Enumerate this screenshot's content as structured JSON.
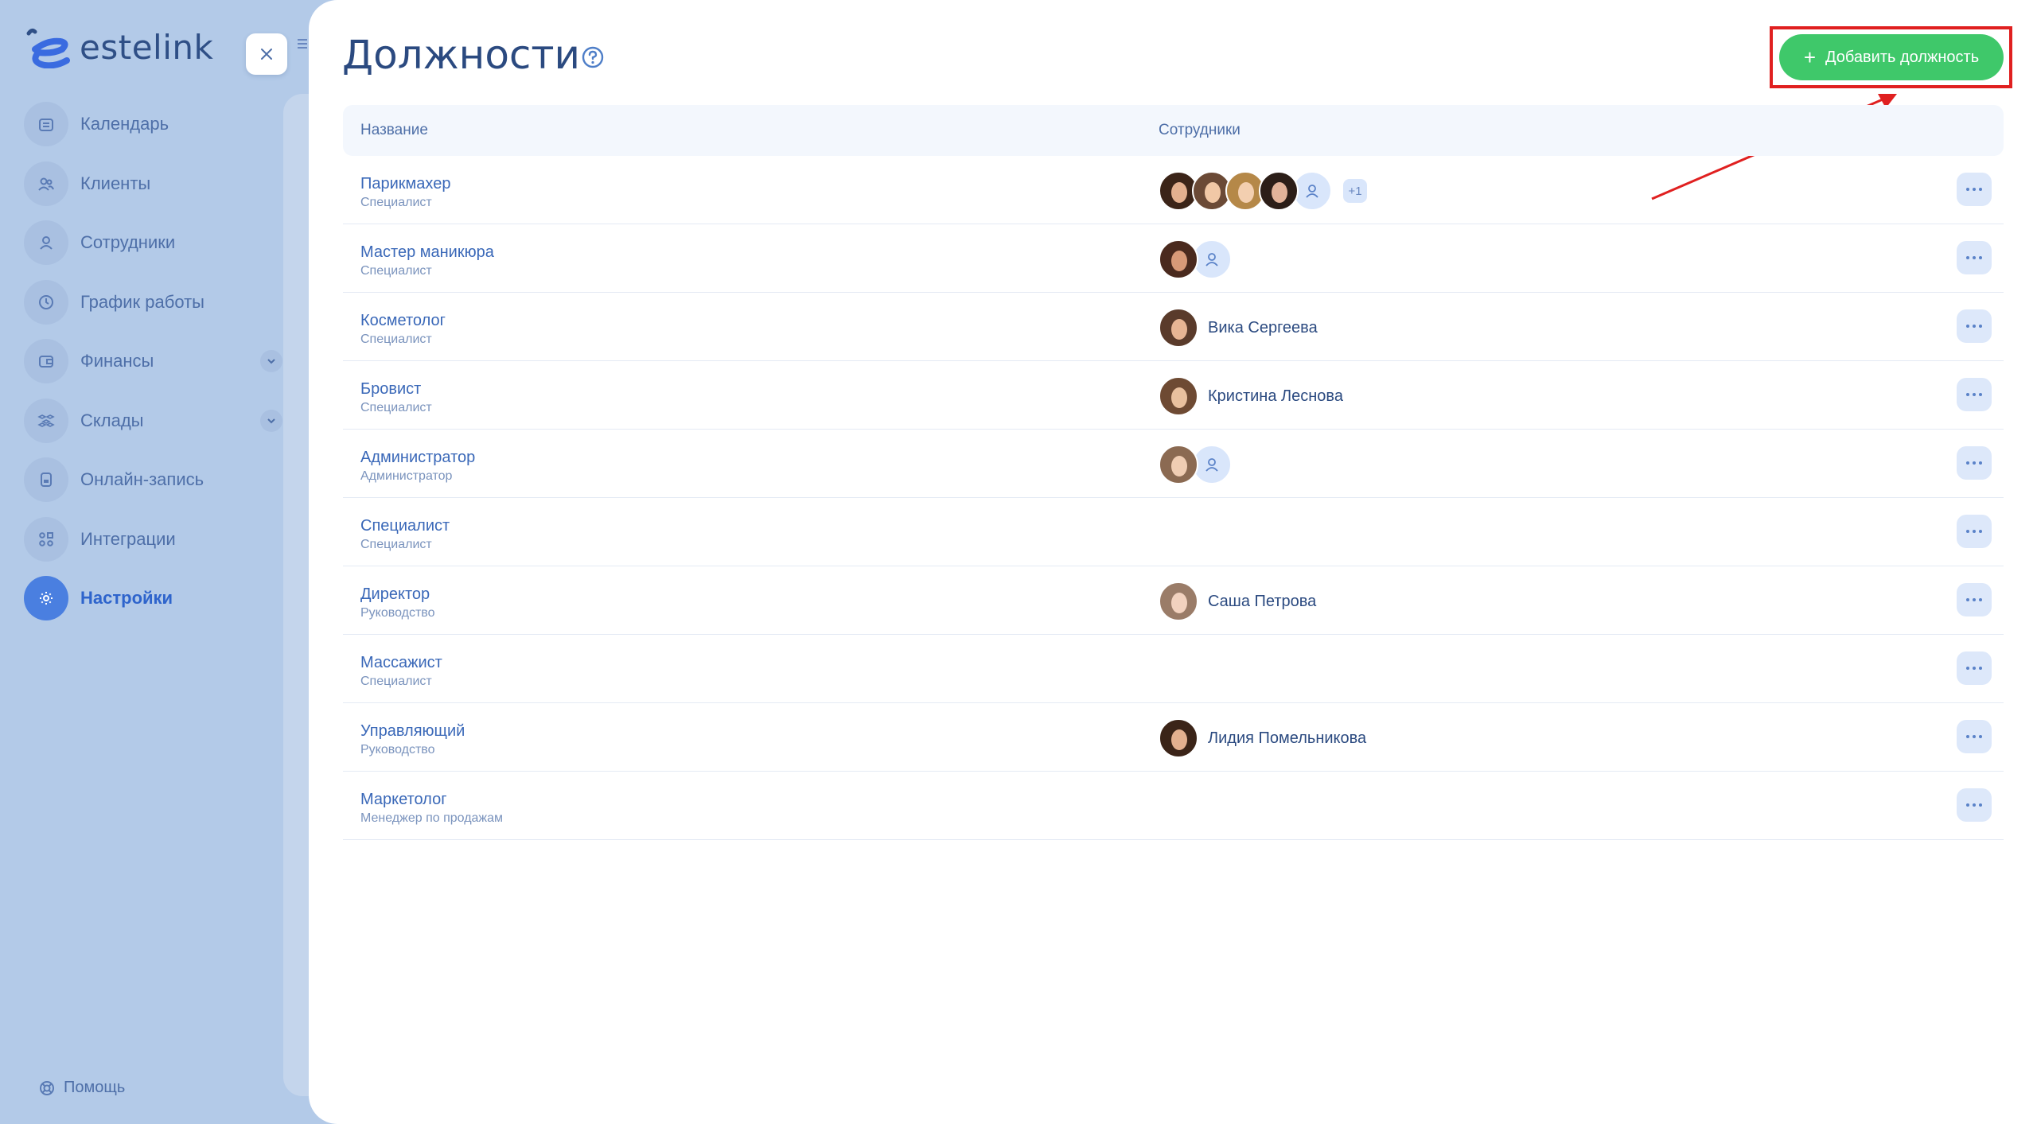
{
  "app": {
    "logo_text": "estelink"
  },
  "sidebar": {
    "items": [
      {
        "label": "Календарь",
        "icon": "calendar-icon"
      },
      {
        "label": "Клиенты",
        "icon": "clients-icon"
      },
      {
        "label": "Сотрудники",
        "icon": "employee-icon"
      },
      {
        "label": "График работы",
        "icon": "clock-icon"
      },
      {
        "label": "Финансы",
        "icon": "wallet-icon",
        "expandable": true
      },
      {
        "label": "Склады",
        "icon": "boxes-icon",
        "expandable": true
      },
      {
        "label": "Онлайн-запись",
        "icon": "phone-icon"
      },
      {
        "label": "Интеграции",
        "icon": "grid-icon"
      },
      {
        "label": "Настройки",
        "icon": "gear-icon",
        "active": true
      }
    ],
    "help_label": "Помощь"
  },
  "page": {
    "title": "Должности",
    "add_button": "Добавить должность"
  },
  "table": {
    "headers": {
      "name": "Название",
      "employees": "Сотрудники"
    },
    "rows": [
      {
        "name": "Парикмахер",
        "category": "Специалист",
        "employee_name": "",
        "avatars": 4,
        "placeholder": true,
        "extra": "+1"
      },
      {
        "name": "Мастер маникюра",
        "category": "Специалист",
        "employee_name": "",
        "avatars": 1,
        "placeholder": true,
        "extra": ""
      },
      {
        "name": "Косметолог",
        "category": "Специалист",
        "employee_name": "Вика Сергеева",
        "avatars": 1,
        "placeholder": false,
        "extra": ""
      },
      {
        "name": "Бровист",
        "category": "Специалист",
        "employee_name": "Кристина Леснова",
        "avatars": 1,
        "placeholder": false,
        "extra": ""
      },
      {
        "name": "Администратор",
        "category": "Администратор",
        "employee_name": "",
        "avatars": 1,
        "placeholder": true,
        "extra": ""
      },
      {
        "name": "Специалист",
        "category": "Специалист",
        "employee_name": "",
        "avatars": 0,
        "placeholder": false,
        "extra": ""
      },
      {
        "name": "Директор",
        "category": "Руководство",
        "employee_name": "Саша Петрова",
        "avatars": 1,
        "placeholder": false,
        "extra": ""
      },
      {
        "name": "Массажист",
        "category": "Специалист",
        "employee_name": "",
        "avatars": 0,
        "placeholder": false,
        "extra": ""
      },
      {
        "name": "Управляющий",
        "category": "Руководство",
        "employee_name": "Лидия Помельникова",
        "avatars": 1,
        "placeholder": false,
        "extra": ""
      },
      {
        "name": "Маркетолог",
        "category": "Менеджер по продажам",
        "employee_name": "",
        "avatars": 0,
        "placeholder": false,
        "extra": ""
      }
    ]
  },
  "colors": {
    "accent": "#3fc86a",
    "sidebar_bg": "#b3cae8",
    "active": "#4a7fe0",
    "highlight": "#e02020"
  }
}
